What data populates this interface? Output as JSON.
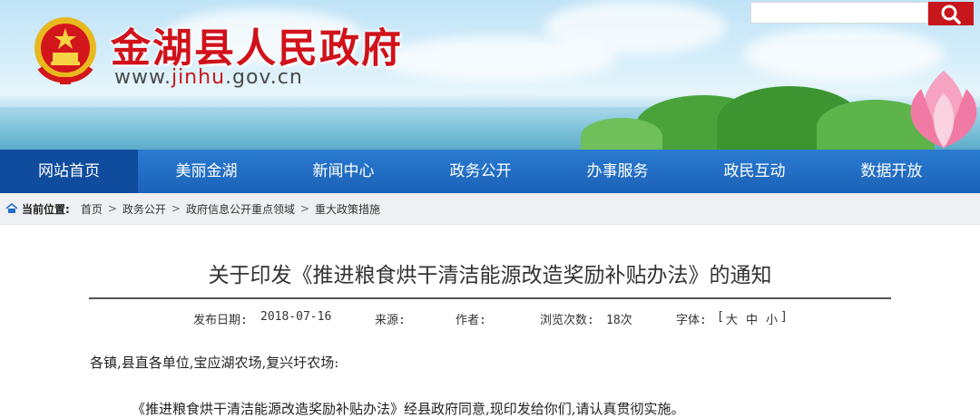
{
  "header": {
    "site_title": "金湖县人民政府",
    "url_prefix": "www.",
    "url_highlight": "jinhu",
    "url_suffix": ".gov.cn",
    "search_placeholder": "",
    "brand_color": "#c8161d"
  },
  "nav": {
    "items": [
      {
        "label": "网站首页",
        "active": true
      },
      {
        "label": "美丽金湖"
      },
      {
        "label": "新闻中心"
      },
      {
        "label": "政务公开"
      },
      {
        "label": "办事服务"
      },
      {
        "label": "政民互动"
      },
      {
        "label": "数据开放"
      }
    ],
    "color": "#1f6cc4"
  },
  "breadcrumb": {
    "label": "当前位置:",
    "items": [
      "首页",
      "政务公开",
      "政府信息公开重点领域",
      "重大政策措施"
    ],
    "separator": ">"
  },
  "article": {
    "title": "关于印发《推进粮食烘干清洁能源改造奖励补贴办法》的通知",
    "meta": {
      "date_label": "发布日期:",
      "date": "2018-07-16",
      "source_label": "来源:",
      "source": "",
      "author_label": "作者:",
      "author": "",
      "views_label": "浏览次数:",
      "views": "18次",
      "font_label": "字体:",
      "font_open": "[",
      "font_large": "大",
      "font_medium": "中",
      "font_small": "小",
      "font_close": "]"
    },
    "greeting": "各镇,县直各单位,宝应湖农场,复兴圩农场:",
    "body": "《推进粮食烘干清洁能源改造奖励补贴办法》经县政府同意,现印发给你们,请认真贯彻实施。"
  }
}
